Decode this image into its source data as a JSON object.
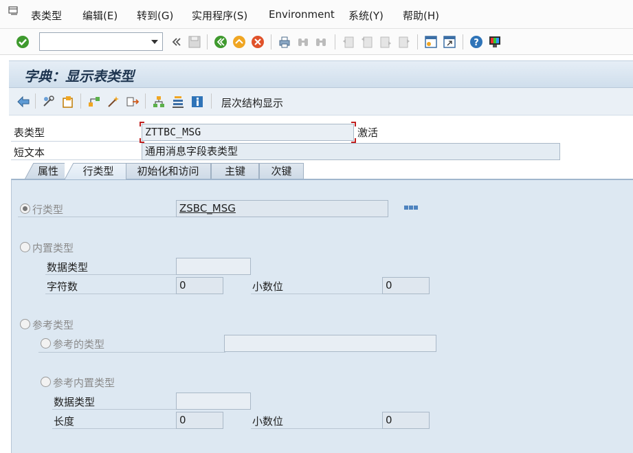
{
  "menubar": {
    "icon": "menu-window-icon",
    "items": [
      "表类型",
      "编辑(E)",
      "转到(G)",
      "实用程序(S)",
      "Environment",
      "系统(Y)",
      "帮助(H)"
    ]
  },
  "toolbar": {
    "command_field_value": "",
    "icons": [
      "enter-check-icon",
      "double-arrow-icon",
      "save-icon",
      "back-icon",
      "exit-icon",
      "cancel-icon",
      "print-icon",
      "find-icon",
      "find-next-icon",
      "first-page-icon",
      "previous-page-icon",
      "next-page-icon",
      "last-page-icon",
      "create-session-icon",
      "shortcut-icon",
      "help-icon",
      "customize-layout-icon"
    ]
  },
  "title": "字典：显示表类型",
  "app_toolbar": {
    "icons": [
      "back-arrow-icon",
      "display-change-icon",
      "activate-icon",
      "where-used-icon",
      "technical-settings-icon",
      "object-directory-icon",
      "hierarchy-icon",
      "stack-icon",
      "info-icon"
    ],
    "label": "层次结构显示"
  },
  "header": {
    "table_type_label": "表类型",
    "table_type_value": "ZTTBC_MSG",
    "status": "激活",
    "short_text_label": "短文本",
    "short_text_value": "通用消息字段表类型"
  },
  "tabs": [
    {
      "label": "属性",
      "active": false
    },
    {
      "label": "行类型",
      "active": true
    },
    {
      "label": "初始化和访问",
      "active": false
    },
    {
      "label": "主键",
      "active": false
    },
    {
      "label": "次键",
      "active": false
    }
  ],
  "line_type": {
    "row_type_label": "行类型",
    "row_type_value": "ZSBC_MSG",
    "builtin_type_label": "内置类型",
    "data_type_label": "数据类型",
    "data_type_value": "",
    "chars_label": "字符数",
    "chars_value": "0",
    "decimals_label": "小数位",
    "decimals_value": "0",
    "ref_type_label": "参考类型",
    "ref_of_type_label": "参考的类型",
    "ref_of_type_value": "",
    "ref_builtin_label": "参考内置类型",
    "ref_data_type_label": "数据类型",
    "ref_data_type_value": "",
    "length_label": "长度",
    "length_value": "0",
    "ref_decimals_label": "小数位",
    "ref_decimals_value": "0"
  }
}
